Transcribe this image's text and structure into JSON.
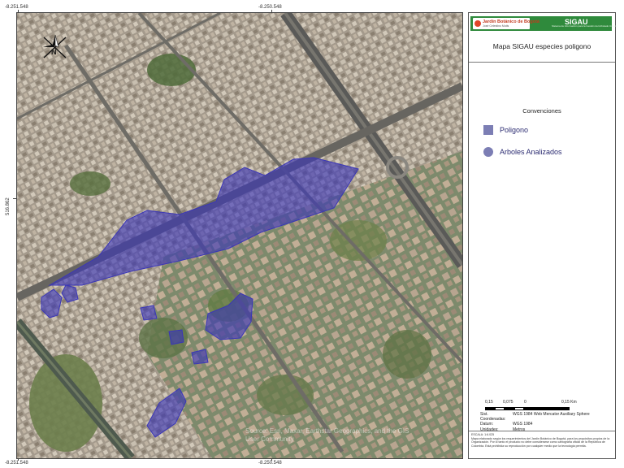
{
  "coordinates": {
    "top_left": "-8.251.548",
    "top_center": "-8.250.548",
    "bottom_left": "-8.251.548",
    "bottom_center": "-8.250.548",
    "left_middle": "516.862"
  },
  "north_arrow": {
    "label": "N",
    "icon": "north-arrow-icon"
  },
  "attribution": "Source: Esri, Maxar, Earthstar Geographics, and the GIS User Community",
  "panel": {
    "logo_name": "Jardín Botánico de Bogotá",
    "logo_sub": "José Celestino Mutis",
    "brand": "SIGAU",
    "brand_sub": "Sistema de Información para la Gestión del Arbolado Urbano",
    "map_title": "Mapa SIGAU especies poligono",
    "conventions_title": "Convenciones",
    "legend": [
      {
        "label": "Poligono",
        "symbol": "square",
        "color": "#7c7eb4"
      },
      {
        "label": "Arboles Analizados",
        "symbol": "circle",
        "color": "#7c7eb4"
      }
    ],
    "scale": {
      "ticks": [
        "0,15",
        "0,075",
        "0",
        "0,15 Km"
      ]
    },
    "crs": [
      {
        "key": "Sist. Coordenadas:",
        "value": "WGS 1984 Web Mercator Auxiliary Sphere"
      },
      {
        "key": "Datum:",
        "value": "WGS 1984"
      },
      {
        "key": "Unidades:",
        "value": "Metros"
      }
    ],
    "footer": {
      "escala": "ESCALA: 1:6.025",
      "disclaimer": "Mapa elaborado según los requerimientos del Jardín Botánico de Bogotá, para los propósitos propios de la Organización. Por lo tanto el producto no debe considerarse como cartografía oficial de la República de Colombia. Está prohibida su reproducción por cualquier medio que la tecnología permita."
    }
  },
  "colors": {
    "polygon_fill": "#3a36b8",
    "header_green": "#2f8a3c"
  }
}
